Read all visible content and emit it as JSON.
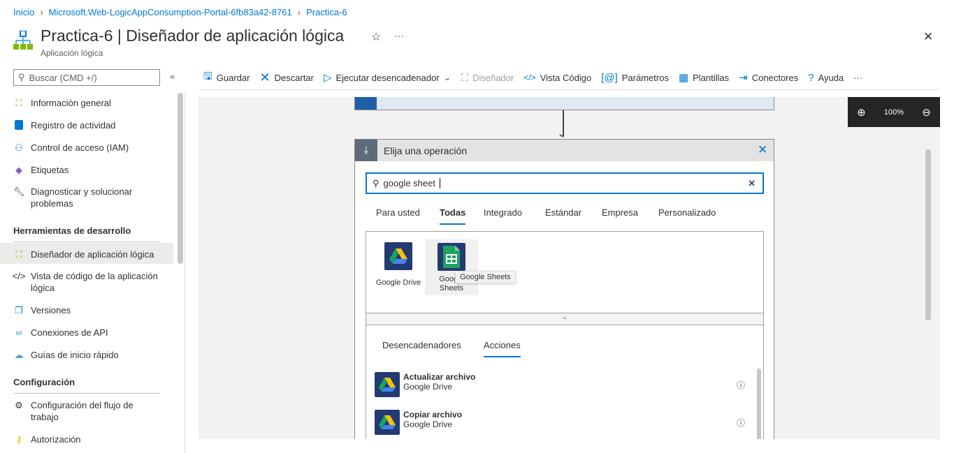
{
  "breadcrumb": [
    "Inicio",
    "Microsoft.Web-LogicAppConsumption-Portal-6fb83a42-8761",
    "Practica-6"
  ],
  "header": {
    "title": "Practica-6 | Diseñador de aplicación lógica",
    "subtitle": "Aplicación lógica",
    "star": "☆",
    "more": "···",
    "close": "✕"
  },
  "sidebar": {
    "search_placeholder": "Buscar (CMD +/)",
    "collapse": "«",
    "items": [
      {
        "label": "Información general"
      },
      {
        "label": "Registro de actividad"
      },
      {
        "label": "Control de acceso (IAM)"
      },
      {
        "label": "Etiquetas"
      },
      {
        "label": "Diagnosticar y solucionar problemas"
      }
    ],
    "section1": "Herramientas de desarrollo",
    "dev_items": [
      {
        "label": "Diseñador de aplicación lógica"
      },
      {
        "label": "Vista de código de la aplicación lógica"
      },
      {
        "label": "Versiones"
      },
      {
        "label": "Conexiones de API"
      },
      {
        "label": "Guías de inicio rápido"
      }
    ],
    "section2": "Configuración",
    "config_items": [
      {
        "label": "Configuración del flujo de trabajo"
      },
      {
        "label": "Autorización"
      }
    ]
  },
  "toolbar": {
    "save": "Guardar",
    "discard": "Descartar",
    "run": "Ejecutar desencadenador",
    "designer": "Diseñador",
    "code": "Vista Código",
    "params": "Parámetros",
    "templates": "Plantillas",
    "connectors": "Conectores",
    "help": "Ayuda",
    "more": "···"
  },
  "zoom": {
    "level": "100%"
  },
  "panel": {
    "title": "Elija una operación",
    "search_value": "google sheet",
    "tabs": [
      "Para usted",
      "Todas",
      "Integrado",
      "Estándar",
      "Empresa",
      "Personalizado"
    ],
    "connectors": [
      {
        "label": "Google Drive"
      },
      {
        "label": "Google Sheets"
      }
    ],
    "tooltip": "Google Sheets",
    "subtabs": [
      "Desencadenadores",
      "Acciones"
    ],
    "actions": [
      {
        "title": "Actualizar archivo",
        "connector": "Google Drive"
      },
      {
        "title": "Copiar archivo",
        "connector": "Google Drive"
      }
    ]
  },
  "colors": {
    "accent": "#0078d4",
    "canvas": "#f2f2f2",
    "zoombar": "#252525"
  }
}
